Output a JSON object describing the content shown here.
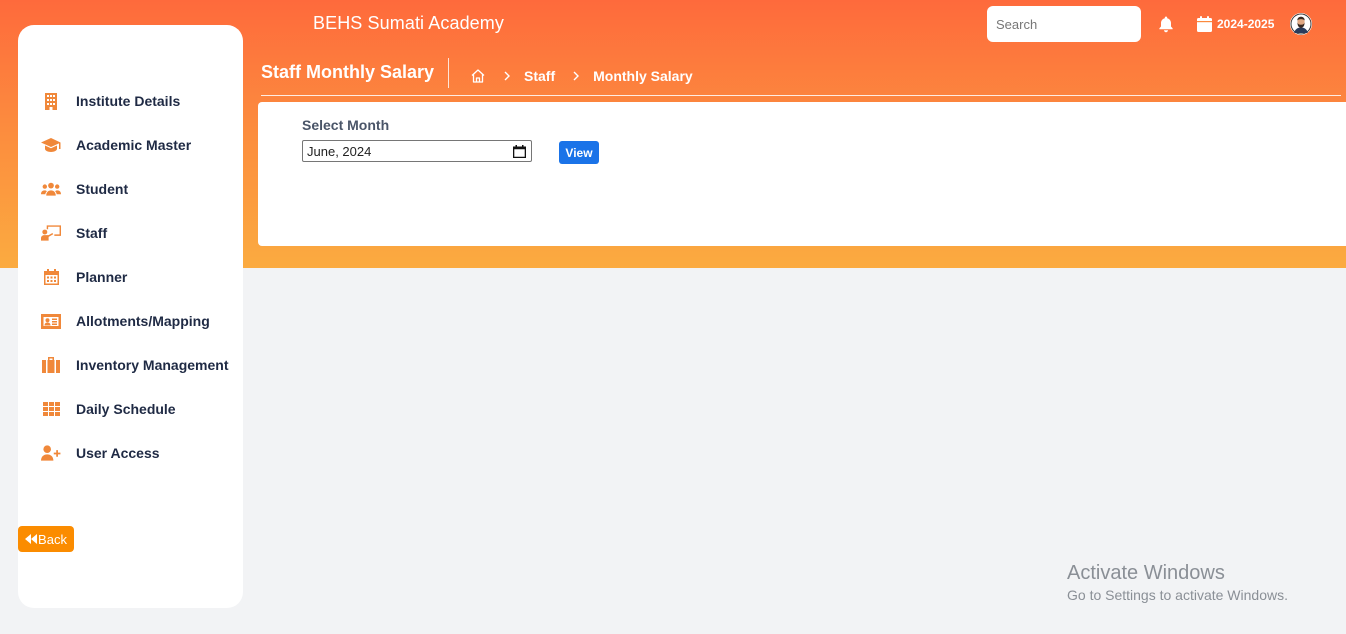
{
  "header": {
    "app_title": "BEHS Sumati Academy",
    "search_placeholder": "Search",
    "session": "2024-2025",
    "page_title": "Staff Monthly Salary",
    "breadcrumb": [
      "Staff",
      "Monthly Salary"
    ],
    "icons": {
      "home": "home-icon",
      "bell": "bell-icon",
      "calendar": "calendar-icon",
      "avatar": "user-avatar"
    }
  },
  "sidebar": {
    "items": [
      {
        "label": "Institute Details",
        "icon": "building-icon"
      },
      {
        "label": "Academic Master",
        "icon": "graduation-cap-icon"
      },
      {
        "label": "Student",
        "icon": "users-icon"
      },
      {
        "label": "Staff",
        "icon": "teacher-board-icon"
      },
      {
        "label": "Planner",
        "icon": "calendar-icon"
      },
      {
        "label": "Allotments/Mapping",
        "icon": "id-card-icon"
      },
      {
        "label": "Inventory Management",
        "icon": "briefcase-icon"
      },
      {
        "label": "Daily Schedule",
        "icon": "grid-icon"
      },
      {
        "label": "User Access",
        "icon": "user-plus-icon"
      }
    ],
    "back_label": "Back"
  },
  "form": {
    "label": "Select Month",
    "month_value": "June, 2024",
    "view_label": "View"
  },
  "watermark": {
    "title": "Activate Windows",
    "subtitle": "Go to Settings to activate Windows."
  },
  "colors": {
    "header_top": "#fe6a3c",
    "header_bottom": "#fbab40",
    "accent_orange": "#f0883a",
    "back_button": "#fb8c00",
    "view_button": "#1a73e8",
    "sidebar_text": "#1f2a44"
  }
}
